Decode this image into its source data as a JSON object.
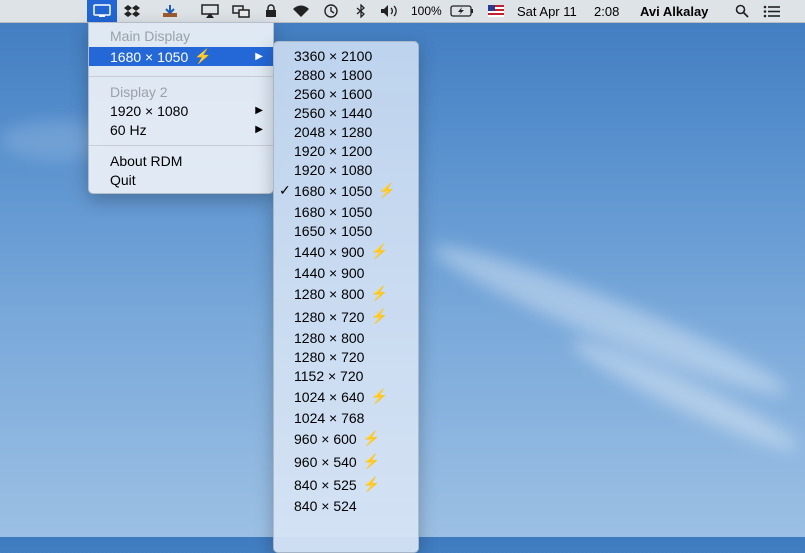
{
  "menubar": {
    "battery_percent": "100%",
    "datetime_day": "Sat Apr 11",
    "datetime_time": "2:08",
    "user_name": "Avi Alkalay"
  },
  "main_menu": {
    "main_display_header": "Main Display",
    "current_resolution": "1680 × 1050",
    "display2_header": "Display 2",
    "display2_resolution": "1920 × 1080",
    "display2_refresh": "60 Hz",
    "about": "About RDM",
    "quit": "Quit"
  },
  "resolutions": [
    {
      "label": "3360 × 2100",
      "hidpi": false,
      "checked": false
    },
    {
      "label": "2880 × 1800",
      "hidpi": false,
      "checked": false
    },
    {
      "label": "2560 × 1600",
      "hidpi": false,
      "checked": false
    },
    {
      "label": "2560 × 1440",
      "hidpi": false,
      "checked": false
    },
    {
      "label": "2048 × 1280",
      "hidpi": false,
      "checked": false
    },
    {
      "label": "1920 × 1200",
      "hidpi": false,
      "checked": false
    },
    {
      "label": "1920 × 1080",
      "hidpi": false,
      "checked": false
    },
    {
      "label": "1680 × 1050",
      "hidpi": true,
      "checked": true
    },
    {
      "label": "1680 × 1050",
      "hidpi": false,
      "checked": false
    },
    {
      "label": "1650 × 1050",
      "hidpi": false,
      "checked": false
    },
    {
      "label": "1440 × 900",
      "hidpi": true,
      "checked": false
    },
    {
      "label": "1440 × 900",
      "hidpi": false,
      "checked": false
    },
    {
      "label": "1280 × 800",
      "hidpi": true,
      "checked": false
    },
    {
      "label": "1280 × 720",
      "hidpi": true,
      "checked": false
    },
    {
      "label": "1280 × 800",
      "hidpi": false,
      "checked": false
    },
    {
      "label": "1280 × 720",
      "hidpi": false,
      "checked": false
    },
    {
      "label": "1152 × 720",
      "hidpi": false,
      "checked": false
    },
    {
      "label": "1024 × 640",
      "hidpi": true,
      "checked": false
    },
    {
      "label": "1024 × 768",
      "hidpi": false,
      "checked": false
    },
    {
      "label": "960 × 600",
      "hidpi": true,
      "checked": false
    },
    {
      "label": "960 × 540",
      "hidpi": true,
      "checked": false
    },
    {
      "label": "840 × 525",
      "hidpi": true,
      "checked": false
    },
    {
      "label": "840 × 524",
      "hidpi": false,
      "checked": false
    }
  ],
  "icons": {
    "bolt": "⚡",
    "check": "✓",
    "submenu_arrow": "▶"
  }
}
